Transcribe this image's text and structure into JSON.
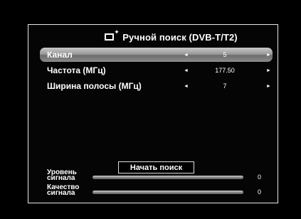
{
  "header": {
    "title": "Ручной поиск (DVB-T/T2)",
    "icon": "tv-search-icon"
  },
  "rows": [
    {
      "label": "Канал",
      "value": "5",
      "selected": true
    },
    {
      "label": "Частота (МГц)",
      "value": "177.50",
      "selected": false
    },
    {
      "label": "Ширина полосы (МГц)",
      "value": "7",
      "selected": false
    }
  ],
  "arrows": {
    "left": "◄",
    "right": "►"
  },
  "search_button": {
    "label": "Начать поиск"
  },
  "meters": {
    "signal_level": {
      "label_line1": "Уровень",
      "label_line2": "сигнала",
      "value": "0",
      "level": 0
    },
    "signal_quality": {
      "label_line1": "Качество",
      "label_line2": "сигнала",
      "value": "0",
      "level": 0
    }
  },
  "colors": {
    "background": "#000000",
    "border": "#e6e6e6",
    "selected_row": "#9a9a9a"
  }
}
